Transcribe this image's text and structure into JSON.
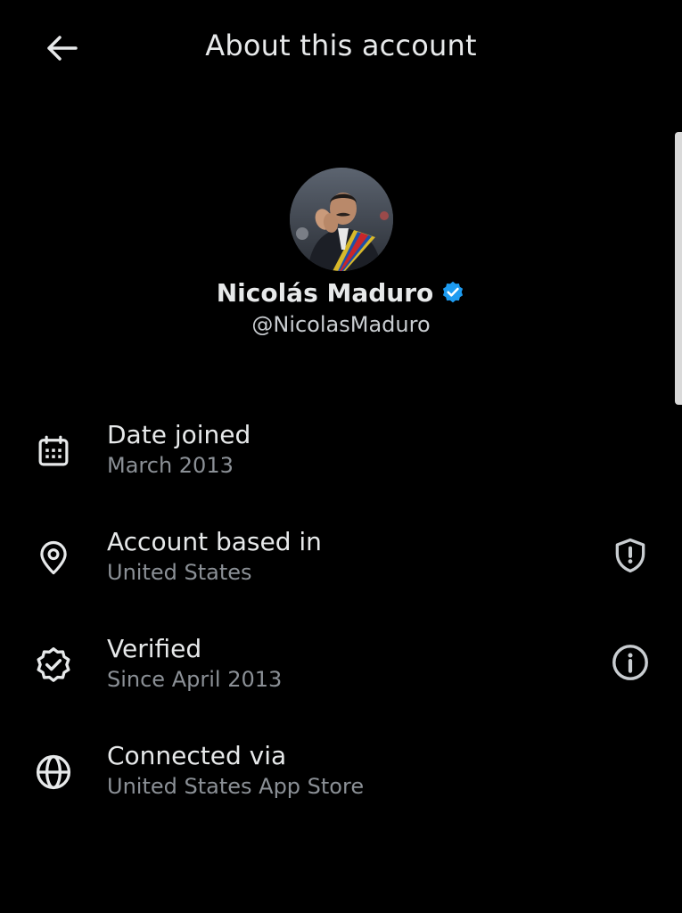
{
  "header": {
    "title": "About this account",
    "back_icon": "arrow-left-icon"
  },
  "profile": {
    "display_name": "Nicolás Maduro",
    "handle": "@NicolasMaduro",
    "verified": true,
    "verified_color": "#1d9bf0"
  },
  "rows": [
    {
      "icon": "calendar-icon",
      "label": "Date joined",
      "value": "March 2013",
      "action_icon": null
    },
    {
      "icon": "location-pin-icon",
      "label": "Account based in",
      "value": "United States",
      "action_icon": "shield-alert-icon"
    },
    {
      "icon": "verified-badge-outline-icon",
      "label": "Verified",
      "value": "Since April 2013",
      "action_icon": "info-icon"
    },
    {
      "icon": "globe-icon",
      "label": "Connected via",
      "value": "United States App Store",
      "action_icon": null
    }
  ],
  "colors": {
    "background": "#000000",
    "primary_text": "#e7e9ea",
    "secondary_text": "#8b9096",
    "accent_blue": "#1d9bf0"
  }
}
